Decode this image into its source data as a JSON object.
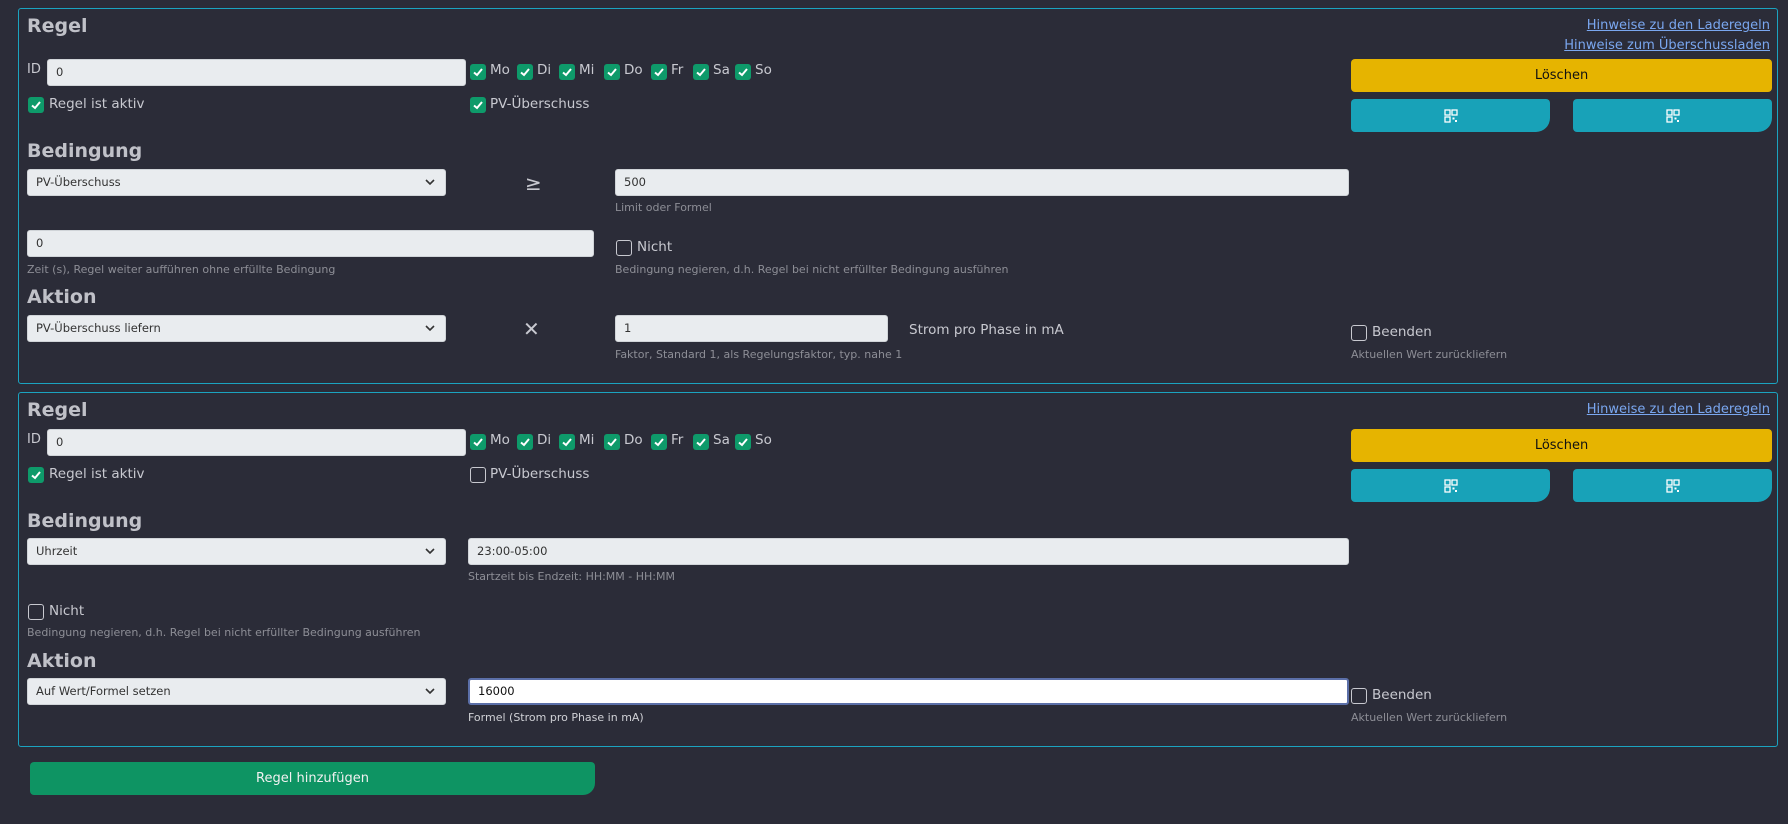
{
  "rules": [
    {
      "title": "Regel",
      "links": [
        "Hinweise zu den Laderegeln",
        "Hinweise zum Überschussladen"
      ],
      "id_label": "ID",
      "id_value": "0",
      "days": [
        {
          "label": "Mo",
          "checked": true
        },
        {
          "label": "Di",
          "checked": true
        },
        {
          "label": "Mi",
          "checked": true
        },
        {
          "label": "Do",
          "checked": true
        },
        {
          "label": "Fr",
          "checked": true
        },
        {
          "label": "Sa",
          "checked": true
        },
        {
          "label": "So",
          "checked": true
        }
      ],
      "active_label": "Regel ist aktiv",
      "active_checked": true,
      "pv_label": "PV-Überschuss",
      "pv_checked": true,
      "delete_label": "Löschen",
      "condition_title": "Bedingung",
      "condition_select": "PV-Überschuss",
      "condition_operator": "≥",
      "limit_value": "500",
      "limit_hint": "Limit oder Formel",
      "time_value": "0",
      "time_hint": "Zeit (s), Regel weiter aufführen ohne erfüllte Bedingung",
      "not_label": "Nicht",
      "not_checked": false,
      "not_hint": "Bedingung negieren, d.h. Regel bei nicht erfüllter Bedingung ausführen",
      "action_title": "Aktion",
      "action_select": "PV-Überschuss liefern",
      "action_operator": "✕",
      "factor_value": "1",
      "factor_hint": "Faktor, Standard 1, als Regelungsfaktor, typ. nahe 1",
      "unit_label": "Strom pro Phase in mA",
      "end_label": "Beenden",
      "end_checked": false,
      "end_hint": "Aktuellen Wert zurückliefern"
    },
    {
      "title": "Regel",
      "links": [
        "Hinweise zu den Laderegeln"
      ],
      "id_label": "ID",
      "id_value": "0",
      "days": [
        {
          "label": "Mo",
          "checked": true
        },
        {
          "label": "Di",
          "checked": true
        },
        {
          "label": "Mi",
          "checked": true
        },
        {
          "label": "Do",
          "checked": true
        },
        {
          "label": "Fr",
          "checked": true
        },
        {
          "label": "Sa",
          "checked": true
        },
        {
          "label": "So",
          "checked": true
        }
      ],
      "active_label": "Regel ist aktiv",
      "active_checked": true,
      "pv_label": "PV-Überschuss",
      "pv_checked": false,
      "delete_label": "Löschen",
      "condition_title": "Bedingung",
      "condition_select": "Uhrzeit",
      "time_range_value": "23:00-05:00",
      "time_range_hint": "Startzeit bis Endzeit: HH:MM - HH:MM",
      "not_label": "Nicht",
      "not_checked": false,
      "not_hint": "Bedingung negieren, d.h. Regel bei nicht erfüllter Bedingung ausführen",
      "action_title": "Aktion",
      "action_select": "Auf Wert/Formel setzen",
      "formula_value": "16000",
      "formula_hint": "Formel (Strom pro Phase in mA)",
      "end_label": "Beenden",
      "end_checked": false,
      "end_hint": "Aktuellen Wert zurückliefern"
    }
  ],
  "add_rule_label": "Regel hinzufügen",
  "colors": {
    "background": "#2b2c38",
    "card_border": "#1ba3c0",
    "checkbox_on": "#0e9a6a",
    "delete_button": "#e6b400",
    "copy_button": "#18a2b8",
    "add_button": "#0e9463"
  }
}
